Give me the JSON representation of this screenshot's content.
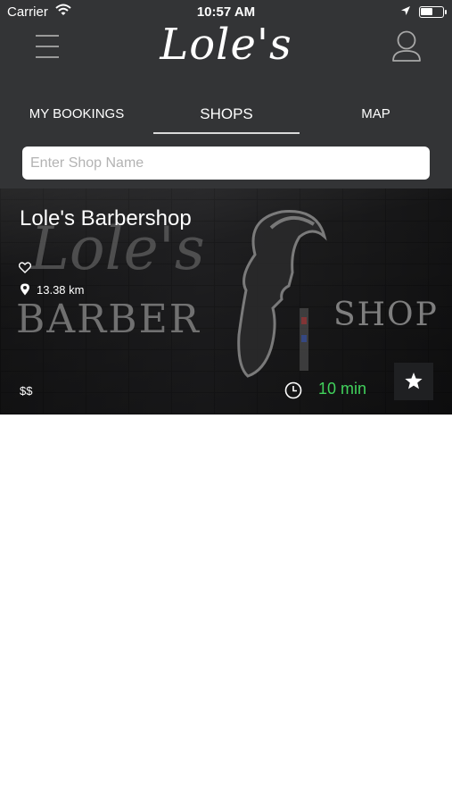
{
  "status_bar": {
    "carrier": "Carrier",
    "time": "10:57 AM",
    "icons": [
      "wifi-icon",
      "location-arrow-icon",
      "battery-icon"
    ]
  },
  "header": {
    "logo": "Lole's",
    "menu_icon": "hamburger-menu-icon",
    "profile_icon": "user-profile-icon"
  },
  "tabs": [
    {
      "label": "MY BOOKINGS",
      "active": false
    },
    {
      "label": "SHOPS",
      "active": true
    },
    {
      "label": "MAP",
      "active": false
    }
  ],
  "search": {
    "placeholder": "Enter Shop Name",
    "value": ""
  },
  "shops": [
    {
      "name": "Lole's Barbershop",
      "distance": "13.38 km",
      "price": "$$",
      "wait_time": "10 min",
      "background_sign": {
        "script": "Lole's",
        "word1": "BARBER",
        "word2": "SHOP"
      },
      "icons": [
        "heart-icon",
        "location-pin-icon",
        "clock-icon",
        "star-icon"
      ]
    }
  ],
  "colors": {
    "header_bg": "#333436",
    "wait_time": "#41d25c",
    "page_bg": "#ffffff"
  }
}
